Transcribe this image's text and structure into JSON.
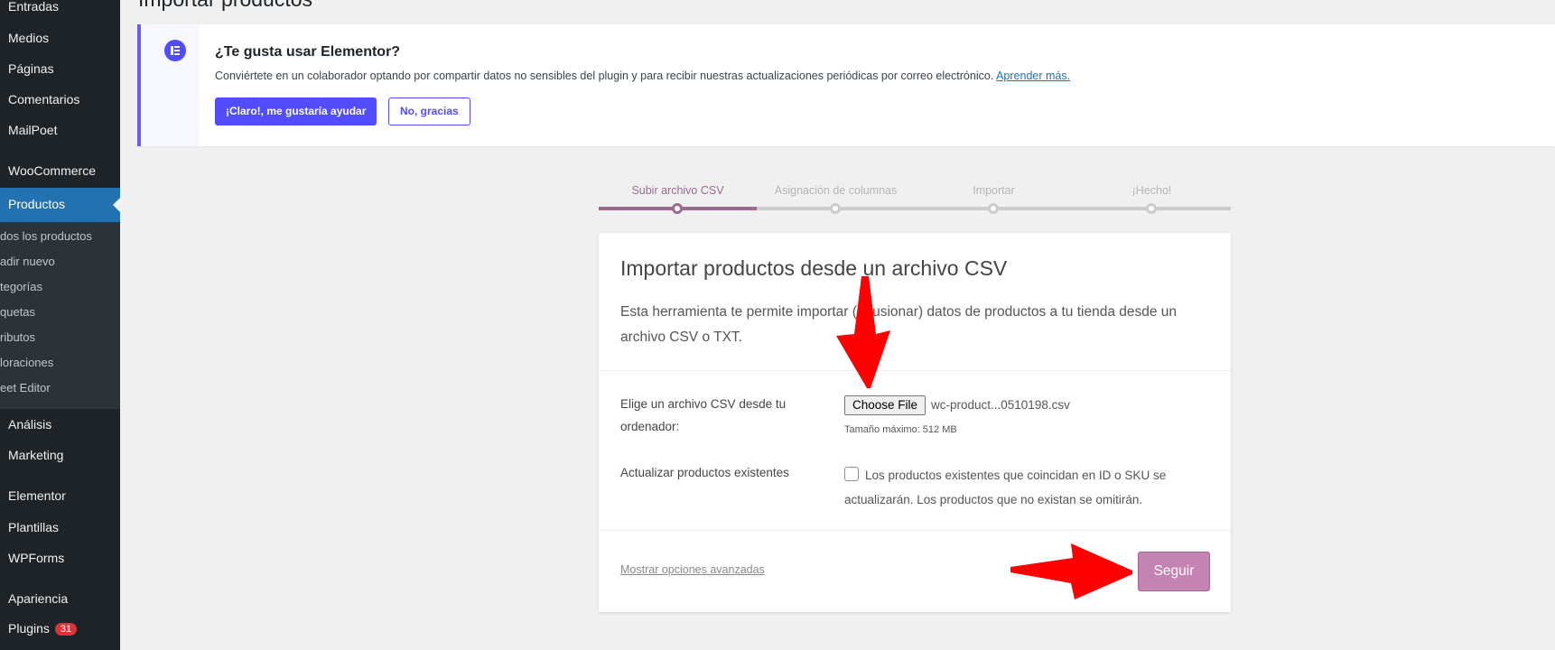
{
  "sidebar": {
    "items": [
      {
        "label": "Entradas"
      },
      {
        "label": "Medios"
      },
      {
        "label": "Páginas"
      },
      {
        "label": "Comentarios"
      },
      {
        "label": "MailPoet"
      },
      {
        "label": "WooCommerce"
      },
      {
        "label": "Productos"
      },
      {
        "label": "Análisis"
      },
      {
        "label": "Marketing"
      },
      {
        "label": "Elementor"
      },
      {
        "label": "Plantillas"
      },
      {
        "label": "WPForms"
      },
      {
        "label": "Apariencia"
      },
      {
        "label": "Plugins",
        "badge": "31"
      }
    ],
    "submenu": [
      "dos los productos",
      "adir nuevo",
      "tegorías",
      "quetas",
      "ributos",
      "loraciones",
      "eet Editor"
    ]
  },
  "page": {
    "title": "Importar productos"
  },
  "notice": {
    "title": "¿Te gusta usar Elementor?",
    "text": "Conviértete en un colaborador optando por compartir datos no sensibles del plugin y para recibir nuestras actualizaciones periódicas por correo electrónico.",
    "link": "Aprender más.",
    "primary_button": "¡Claro!, me gustaría ayudar",
    "secondary_button": "No, gracias"
  },
  "steps": [
    {
      "label": "Subir archivo CSV",
      "active": true
    },
    {
      "label": "Asignación de columnas",
      "active": false
    },
    {
      "label": "Importar",
      "active": false
    },
    {
      "label": "¡Hecho!",
      "active": false
    }
  ],
  "card": {
    "title": "Importar productos desde un archivo CSV",
    "description": "Esta herramienta te permite importar (o fusionar) datos de productos a tu tienda desde un archivo CSV o TXT.",
    "file_label": "Elige un archivo CSV desde tu ordenador:",
    "choose_button": "Choose File",
    "file_name": "wc-product...0510198.csv",
    "max_size": "Tamaño máximo: 512 MB",
    "update_label": "Actualizar productos existentes",
    "update_text": "Los productos existentes que coincidan en ID o SKU se actualizarán. Los productos que no existan se omitirán.",
    "advanced_link": "Mostrar opciones avanzadas",
    "continue_button": "Seguir"
  },
  "colors": {
    "sidebar_bg": "#1d2327",
    "active_menu": "#2271b1",
    "elementor_accent": "#524cff",
    "woo_purple": "#9a6a8f",
    "continue_button": "#c383b3",
    "annotation_arrow": "#ff0000"
  }
}
